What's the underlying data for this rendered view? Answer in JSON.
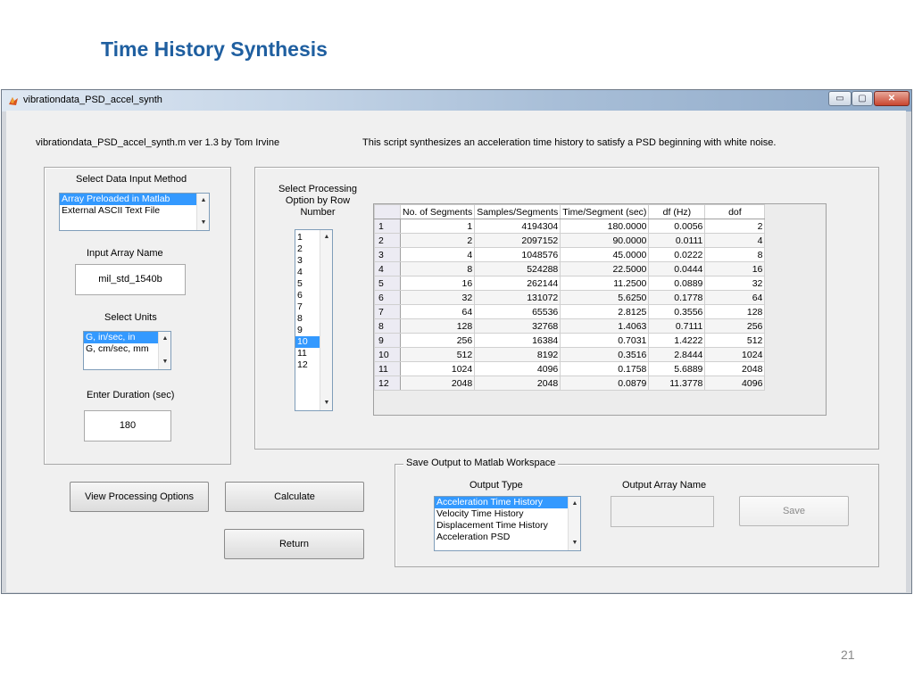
{
  "slide": {
    "title": "Time History Synthesis",
    "page_number": "21"
  },
  "window": {
    "title": "vibrationdata_PSD_accel_synth",
    "minimize": "▭",
    "maximize": "▢",
    "close": "✕"
  },
  "header": {
    "left_text": "vibrationdata_PSD_accel_synth.m  ver 1.3  by Tom Irvine",
    "right_text": "This script synthesizes an acceleration time history to satisfy a PSD beginning with white noise."
  },
  "input_method": {
    "label": "Select Data Input Method",
    "options": [
      "Array Preloaded in Matlab",
      "External ASCII Text File"
    ],
    "selected_index": 0
  },
  "input_array": {
    "label": "Input Array Name",
    "value": "mil_std_1540b"
  },
  "units": {
    "label": "Select Units",
    "options": [
      "G, in/sec, in",
      "G, cm/sec, mm"
    ],
    "selected_index": 0
  },
  "duration": {
    "label": "Enter Duration (sec)",
    "value": "180"
  },
  "processing": {
    "label_lines": [
      "Select Processing",
      "Option by Row",
      "Number"
    ],
    "options": [
      "1",
      "2",
      "3",
      "4",
      "5",
      "6",
      "7",
      "8",
      "9",
      "10",
      "11",
      "12"
    ],
    "selected_index": 9
  },
  "table": {
    "columns": [
      "No. of Segments",
      "Samples/Segments",
      "Time/Segment (sec)",
      "df (Hz)",
      "dof"
    ],
    "rows": [
      [
        "1",
        "1",
        "4194304",
        "180.0000",
        "0.0056",
        "2"
      ],
      [
        "2",
        "2",
        "2097152",
        "90.0000",
        "0.0111",
        "4"
      ],
      [
        "3",
        "4",
        "1048576",
        "45.0000",
        "0.0222",
        "8"
      ],
      [
        "4",
        "8",
        "524288",
        "22.5000",
        "0.0444",
        "16"
      ],
      [
        "5",
        "16",
        "262144",
        "11.2500",
        "0.0889",
        "32"
      ],
      [
        "6",
        "32",
        "131072",
        "5.6250",
        "0.1778",
        "64"
      ],
      [
        "7",
        "64",
        "65536",
        "2.8125",
        "0.3556",
        "128"
      ],
      [
        "8",
        "128",
        "32768",
        "1.4063",
        "0.7111",
        "256"
      ],
      [
        "9",
        "256",
        "16384",
        "0.7031",
        "1.4222",
        "512"
      ],
      [
        "10",
        "512",
        "8192",
        "0.3516",
        "2.8444",
        "1024"
      ],
      [
        "11",
        "1024",
        "4096",
        "0.1758",
        "5.6889",
        "2048"
      ],
      [
        "12",
        "2048",
        "2048",
        "0.0879",
        "11.3778",
        "4096"
      ]
    ]
  },
  "buttons": {
    "view_processing": "View Processing Options",
    "calculate": "Calculate",
    "return": "Return",
    "save": "Save"
  },
  "save_output": {
    "group_label": "Save Output to Matlab Workspace",
    "output_type_label": "Output Type",
    "output_types": [
      "Acceleration Time History",
      "Velocity Time History",
      "Displacement Time History",
      "Acceleration PSD"
    ],
    "selected_index": 0,
    "output_array_label": "Output Array Name",
    "output_array_value": ""
  },
  "icons": {
    "scroll_up": "▲",
    "scroll_down": "▼"
  },
  "colors": {
    "title_blue": "#1f5fa0",
    "selection": "#3399ff"
  }
}
